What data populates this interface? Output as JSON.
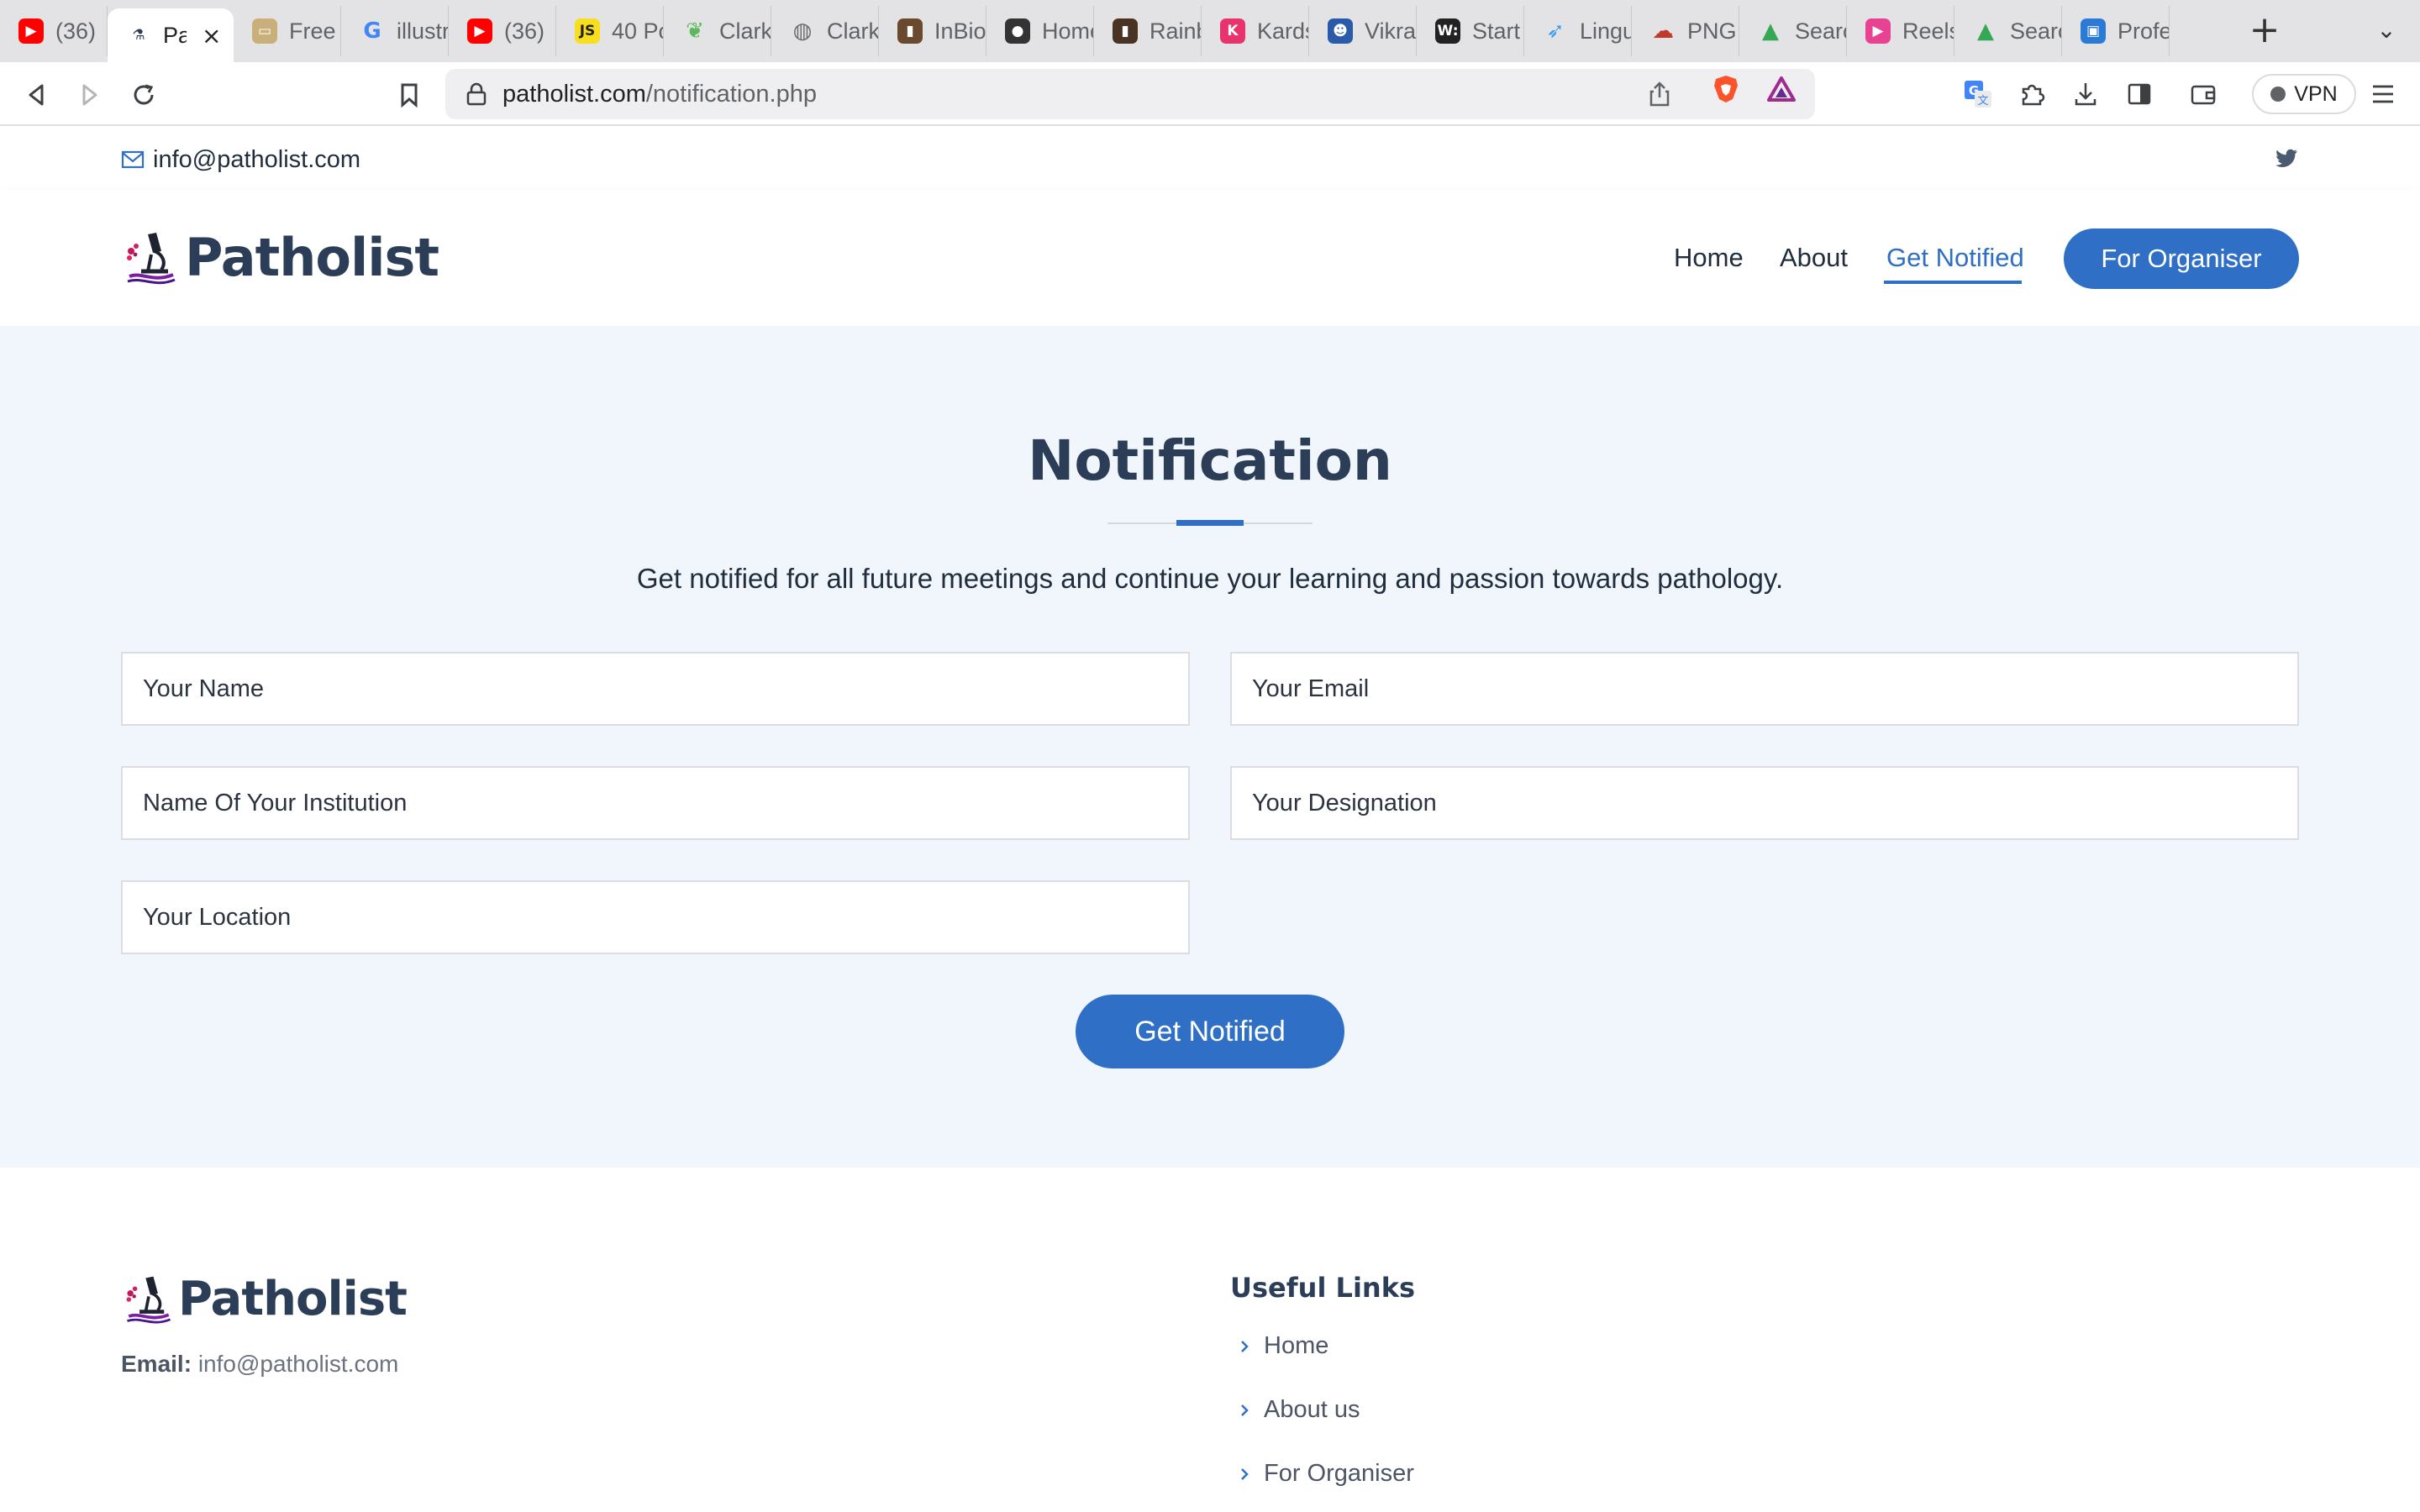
{
  "browser": {
    "tabs": [
      {
        "title": "(36)",
        "icon": "youtube-icon",
        "color": "#ff0000"
      },
      {
        "title": "Pa",
        "icon": "patholist-favicon",
        "color": "#2c3e57",
        "active": true
      },
      {
        "title": "Free",
        "icon": "ticket-icon",
        "color": "#c9b07a"
      },
      {
        "title": "illustr",
        "icon": "google-icon",
        "color": "#4285f4"
      },
      {
        "title": "(36)",
        "icon": "youtube-icon",
        "color": "#ff0000"
      },
      {
        "title": "40 Pc",
        "icon": "js-icon",
        "color": "#f7df1e"
      },
      {
        "title": "Clark",
        "icon": "leaf-icon",
        "color": "#5cb85c"
      },
      {
        "title": "Clark",
        "icon": "globe-icon",
        "color": "#6b6b6b"
      },
      {
        "title": "InBio",
        "icon": "portrait-icon",
        "color": "#6a4a2e"
      },
      {
        "title": "Home",
        "icon": "avatar-icon",
        "color": "#333333"
      },
      {
        "title": "Rainb",
        "icon": "portrait-icon",
        "color": "#4a3322"
      },
      {
        "title": "Kards",
        "icon": "k-icon",
        "color": "#e8336d"
      },
      {
        "title": "Vikra",
        "icon": "person-icon",
        "color": "#2b5aa8"
      },
      {
        "title": "Start",
        "icon": "w-icon",
        "color": "#222222"
      },
      {
        "title": "Lingu",
        "icon": "bird-icon",
        "color": "#3aa0e8"
      },
      {
        "title": "PNG",
        "icon": "cloud-icon",
        "color": "#c0392b"
      },
      {
        "title": "Searc",
        "icon": "drive-icon",
        "color": "#34a853"
      },
      {
        "title": "Reels",
        "icon": "play-icon",
        "color": "#e84393"
      },
      {
        "title": "Searc",
        "icon": "drive-icon",
        "color": "#34a853"
      },
      {
        "title": "Profe",
        "icon": "profile-icon",
        "color": "#2b7bd6"
      }
    ],
    "tab_close": "×",
    "new_tab": "+",
    "tab_menu": "⌄",
    "url_host": "patholist.com",
    "url_path": "/notification.php",
    "vpn_label": "VPN"
  },
  "topbar": {
    "email": "info@patholist.com"
  },
  "header": {
    "logo_text": "Patholist",
    "nav": {
      "home": "Home",
      "about": "About",
      "get_notified": "Get Notified",
      "organiser": "For Organiser"
    }
  },
  "notification": {
    "title": "Notification",
    "subtitle": "Get notified for all future meetings and continue your learning and passion towards pathology.",
    "fields": {
      "name": "Your Name",
      "email": "Your Email",
      "institution": "Name Of Your Institution",
      "designation": "Your Designation",
      "location": "Your Location"
    },
    "submit": "Get Notified"
  },
  "footer": {
    "logo_text": "Patholist",
    "email_label": "Email:",
    "email_value": "info@patholist.com",
    "links_title": "Useful Links",
    "links": [
      "Home",
      "About us",
      "For Organiser"
    ]
  },
  "colors": {
    "accent": "#2f6fc5",
    "heading": "#2c3e57",
    "section_bg": "#f1f6fd"
  }
}
